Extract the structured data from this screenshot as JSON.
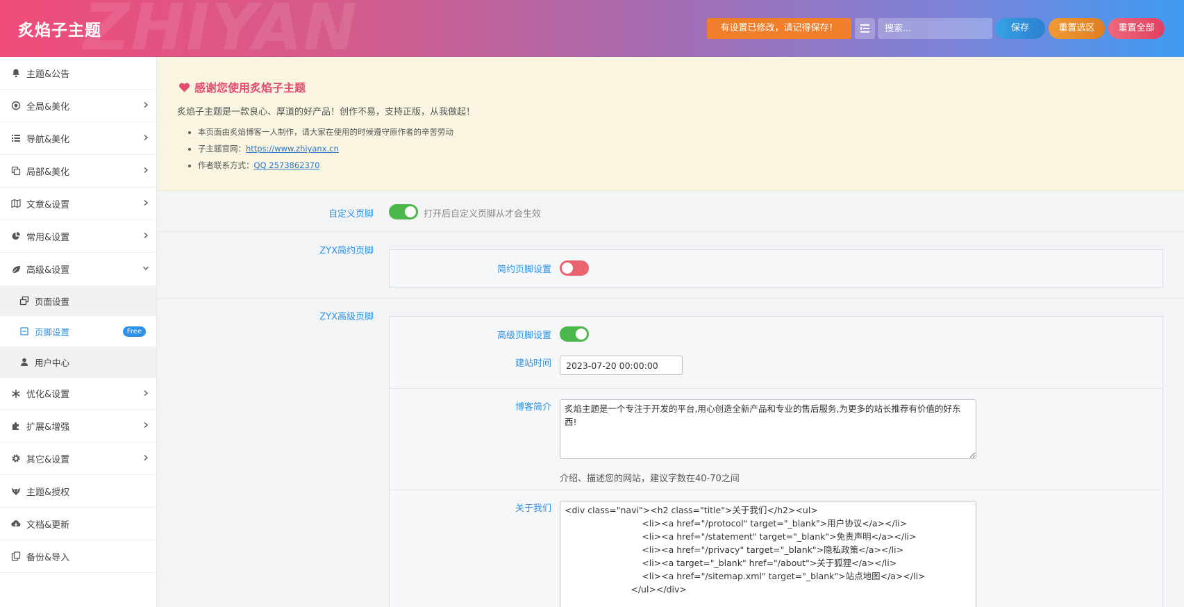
{
  "header": {
    "watermark": "ZHIYAN",
    "brand": "炙焰子主题",
    "notice": "有设置已修改，请记得保存！",
    "search_placeholder": "搜索...",
    "save_label": "保存",
    "reset_section_label": "重置选区",
    "reset_all_label": "重置全部"
  },
  "sidebar": {
    "items": [
      {
        "label": "主题&公告",
        "icon": "bell-icon"
      },
      {
        "label": "全局&美化",
        "icon": "target-icon"
      },
      {
        "label": "导航&美化",
        "icon": "list-icon"
      },
      {
        "label": "局部&美化",
        "icon": "copy-icon"
      },
      {
        "label": "文章&设置",
        "icon": "map-icon"
      },
      {
        "label": "常用&设置",
        "icon": "pie-chart-icon"
      },
      {
        "label": "高级&设置",
        "icon": "leaf-icon"
      },
      {
        "label": "优化&设置",
        "icon": "snowflake-icon"
      },
      {
        "label": "扩展&增强",
        "icon": "puzzle-icon"
      },
      {
        "label": "其它&设置",
        "icon": "gear-icon"
      },
      {
        "label": "主题&授权",
        "icon": "wolf-icon"
      },
      {
        "label": "文档&更新",
        "icon": "cloud-download-icon"
      },
      {
        "label": "备份&导入",
        "icon": "clipboard-icon"
      }
    ],
    "sub_items": [
      {
        "label": "页面设置",
        "icon": "window-restore-icon"
      },
      {
        "label": "页脚设置",
        "icon": "minus-square-icon",
        "badge": "Free"
      },
      {
        "label": "用户中心",
        "icon": "user-icon"
      }
    ]
  },
  "notice": {
    "title": "感谢您使用炙焰子主题",
    "desc": "炙焰子主题是一款良心、厚道的好产品！创作不易，支持正版，从我做起！",
    "bullet1": "本页面由炙焰博客一人制作，请大家在使用的时候遵守原作者的辛苦劳动",
    "bullet2_prefix": "子主题官网：",
    "bullet2_link": "https://www.zhiyanx.cn",
    "bullet3_prefix": "作者联系方式：",
    "bullet3_link": "QQ 2573862370"
  },
  "settings": {
    "custom_footer_label": "自定义页脚",
    "custom_footer_on": true,
    "custom_footer_hint": "打开后自定义页脚从才会生效",
    "simple_footer_label": "ZYX简约页脚",
    "simple_footer_setting_label": "简约页脚设置",
    "simple_footer_on": false,
    "advanced_footer_label": "ZYX高级页脚",
    "advanced_footer_setting_label": "高级页脚设置",
    "advanced_footer_on": true,
    "build_time_label": "建站时间",
    "build_time_value": "2023-07-20 00:00:00",
    "blog_intro_label": "博客简介",
    "blog_intro_value": "炙焰主题是一个专注于开发的平台,用心创造全新产品和专业的售后服务,为更多的站长推荐有价值的好东西!",
    "blog_intro_hint": "介绍、描述您的网站，建议字数在40-70之间",
    "about_label": "关于我们",
    "about_value": "<div class=\"navi\"><h2 class=\"title\">关于我们</h2><ul>\n                            <li><a href=\"/protocol\" target=\"_blank\">用户协议</a></li>\n                            <li><a href=\"/statement\" target=\"_blank\">免责声明</a></li>\n                            <li><a href=\"/privacy\" target=\"_blank\">隐私政策</a></li>\n                            <li><a target=\"_blank\" href=\"/about\">关于狐狸</a></li>\n                            <li><a href=\"/sitemap.xml\" target=\"_blank\">站点地图</a></li>\n                        </ul></div>"
  },
  "colors": {
    "accent": "#2c90e6",
    "toggle_on": "#4cb84c",
    "toggle_off": "#ea6470",
    "notice_bg": "#faf5e0",
    "heart": "#e44c6d"
  }
}
